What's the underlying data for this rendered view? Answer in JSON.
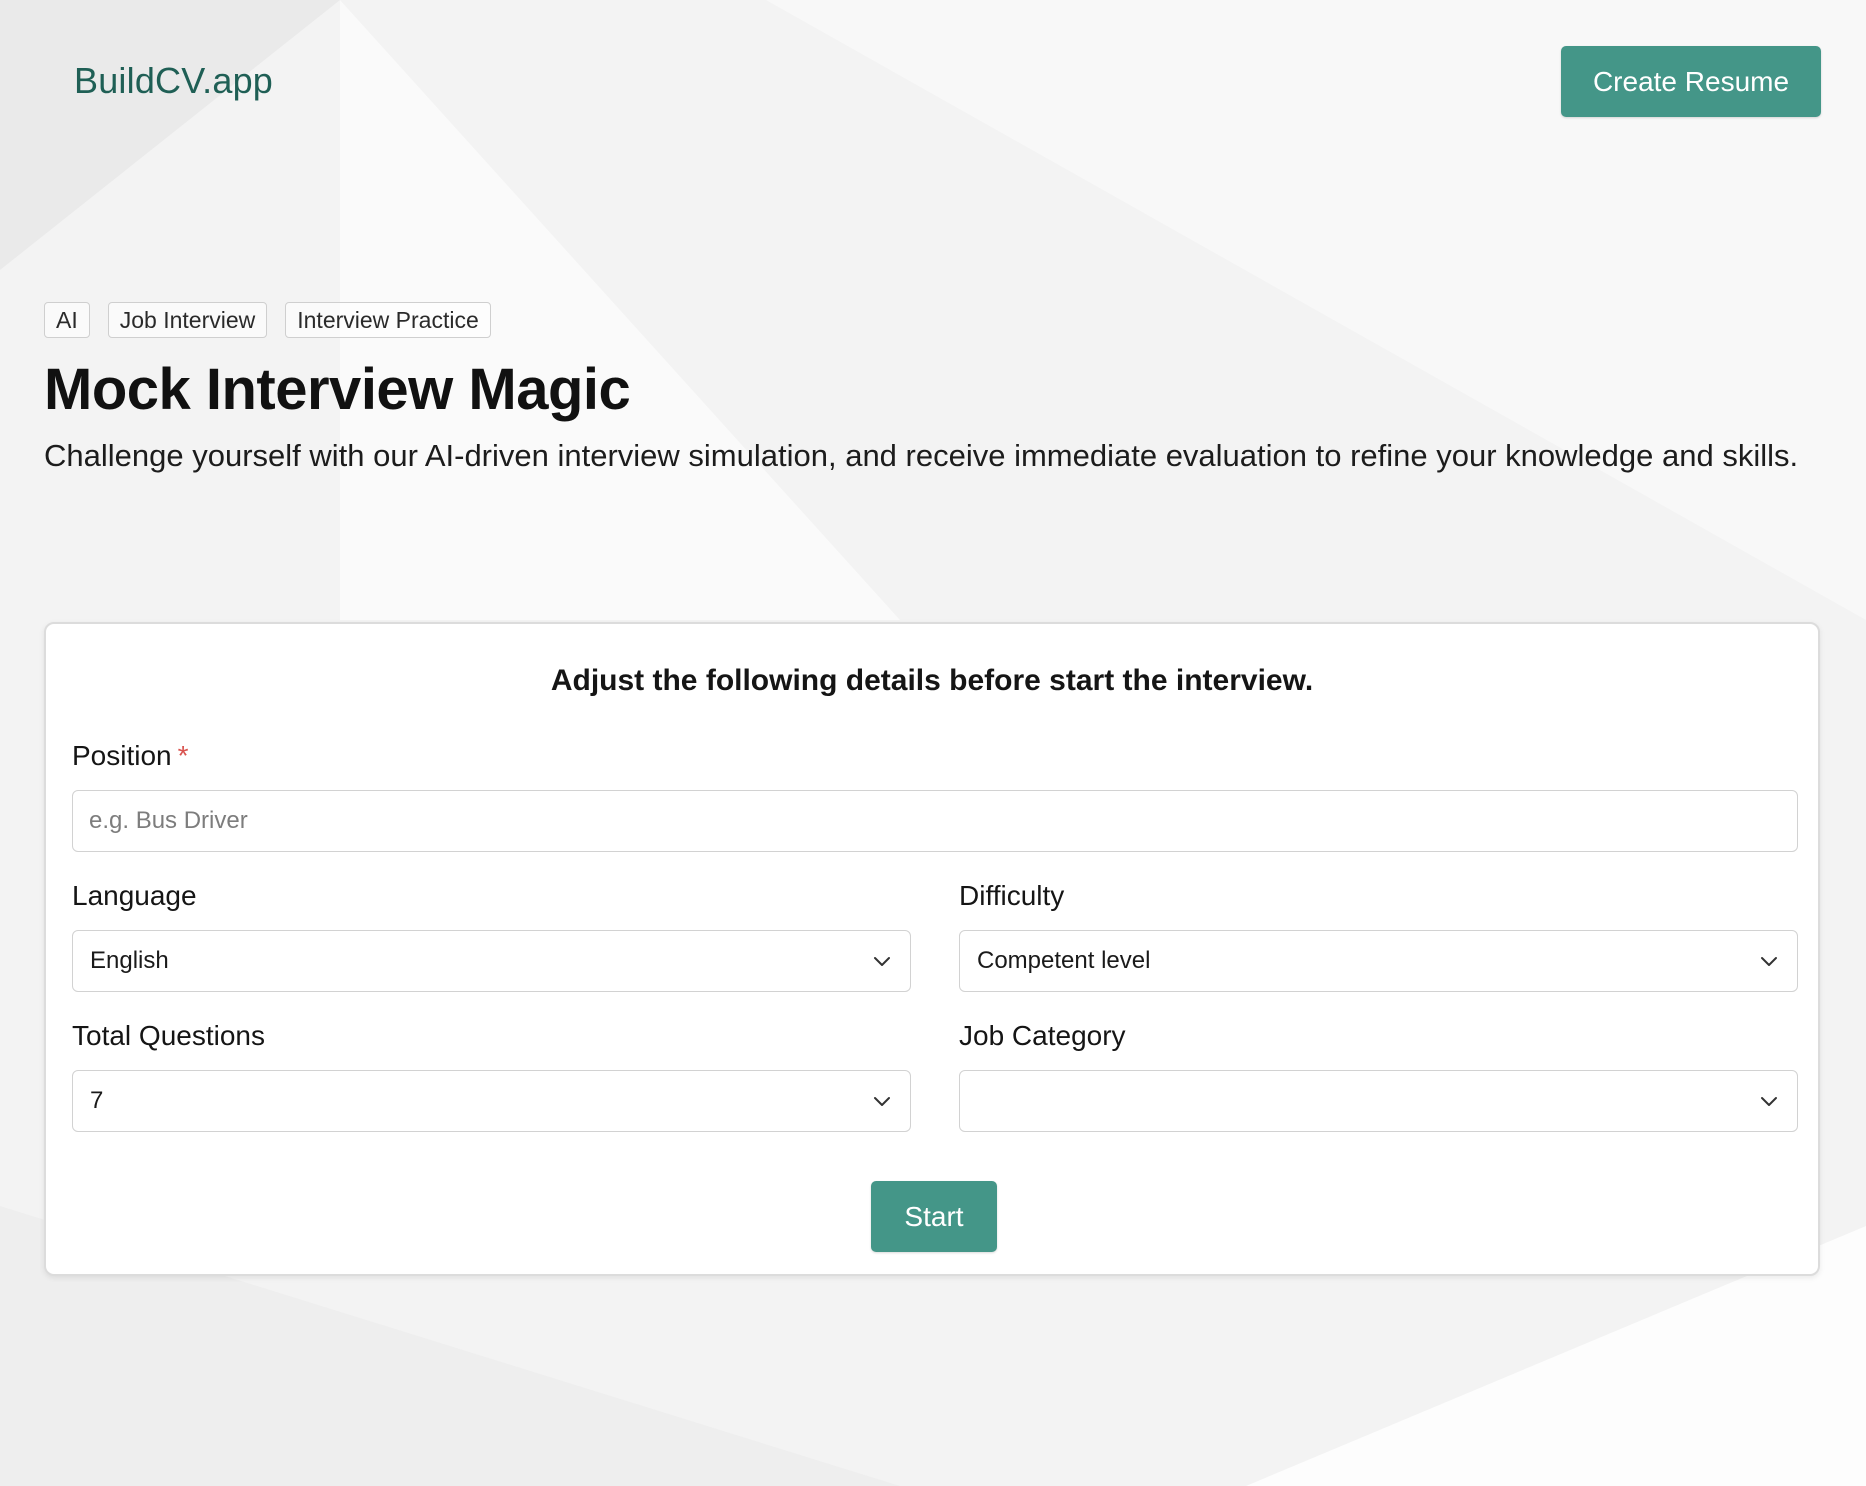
{
  "header": {
    "brand": "BuildCV.app",
    "create_resume_label": "Create Resume"
  },
  "hero": {
    "tags": [
      "AI",
      "Job Interview",
      "Interview Practice"
    ],
    "title": "Mock Interview Magic",
    "subtitle": "Challenge yourself with our AI-driven interview simulation, and receive immediate evaluation to refine your knowledge and skills."
  },
  "form": {
    "heading": "Adjust the following details before start the interview.",
    "position": {
      "label": "Position",
      "required_marker": "*",
      "value": "",
      "placeholder": "e.g. Bus Driver"
    },
    "language": {
      "label": "Language",
      "selected": "English"
    },
    "difficulty": {
      "label": "Difficulty",
      "selected": "Competent level"
    },
    "total_questions": {
      "label": "Total Questions",
      "selected": "7"
    },
    "job_category": {
      "label": "Job Category",
      "selected": ""
    },
    "start_label": "Start"
  },
  "theme": {
    "accent": "#449688",
    "brand_text": "#1f5f55",
    "required": "#d9534f"
  },
  "icons": {
    "select_chevron": "chevron-down-icon"
  }
}
